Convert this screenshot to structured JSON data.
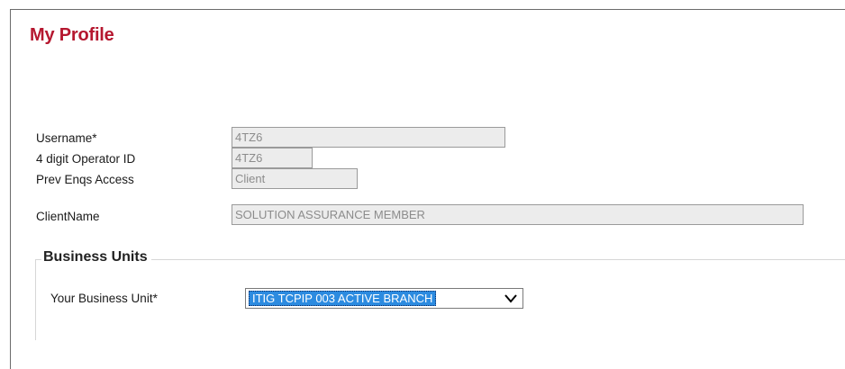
{
  "page": {
    "title": "My Profile"
  },
  "profile": {
    "username": {
      "label": "Username*",
      "value": "4TZ6"
    },
    "operator_id": {
      "label": "4 digit Operator ID",
      "value": "4TZ6"
    },
    "prev_enqs": {
      "label": "Prev Enqs Access",
      "value": "Client"
    },
    "client_name": {
      "label": "ClientName",
      "value": "SOLUTION ASSURANCE MEMBER"
    }
  },
  "business_units": {
    "legend": "Business Units",
    "your_unit": {
      "label": "Your Business Unit*",
      "selected": "ITIG TCPIP 003 ACTIVE BRANCH"
    }
  },
  "icons": {
    "dropdown": "chevron-down-icon"
  },
  "colors": {
    "title": "#b5172f",
    "selection": "#2c8be0",
    "readonly_bg": "#ececec"
  }
}
